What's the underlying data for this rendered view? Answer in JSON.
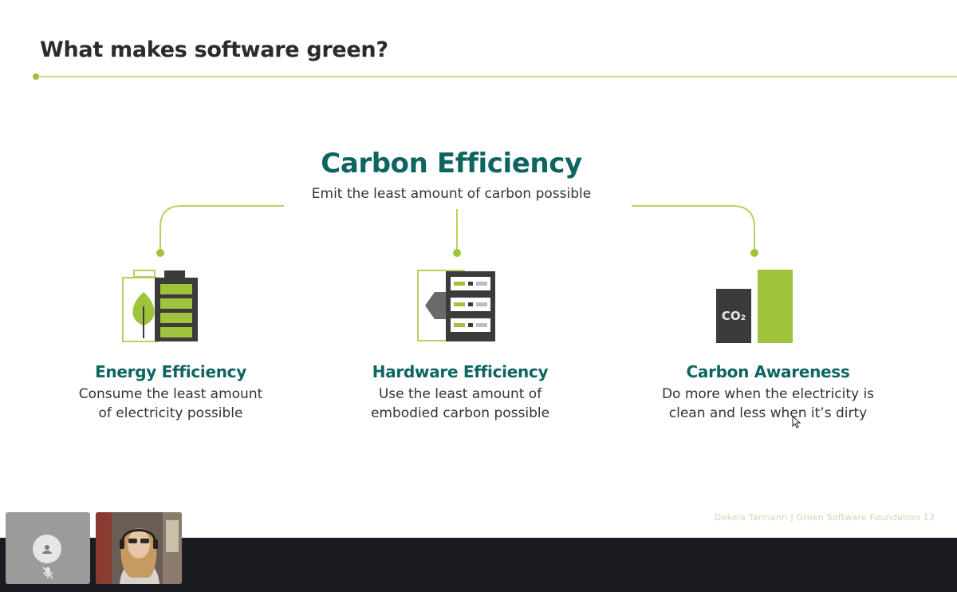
{
  "slide": {
    "title": "What makes software green?",
    "heading": "Carbon Efficiency",
    "heading_sub": "Emit the least amount of carbon possible",
    "footer": "Dekela Tarmann | Green Software Foundation 13",
    "pillars": [
      {
        "title": "Energy Efficiency",
        "description": "Consume the least amount\nof electricity possible",
        "icon": "battery-leaf-icon"
      },
      {
        "title": "Hardware Efficiency",
        "description": "Use the least amount of\nembodied carbon possible",
        "icon": "server-rack-icon"
      },
      {
        "title": "Carbon Awareness",
        "description": "Do more when the electricity is\nclean and less when it’s dirty",
        "icon": "co2-bars-icon",
        "icon_label": "CO₂"
      }
    ]
  },
  "colors": {
    "teal": "#0d6460",
    "lime": "#9fc33b",
    "dark": "#333333"
  },
  "call": {
    "self_tile_icon": "avatar-icon",
    "mic_icon": "mic-off-icon"
  }
}
